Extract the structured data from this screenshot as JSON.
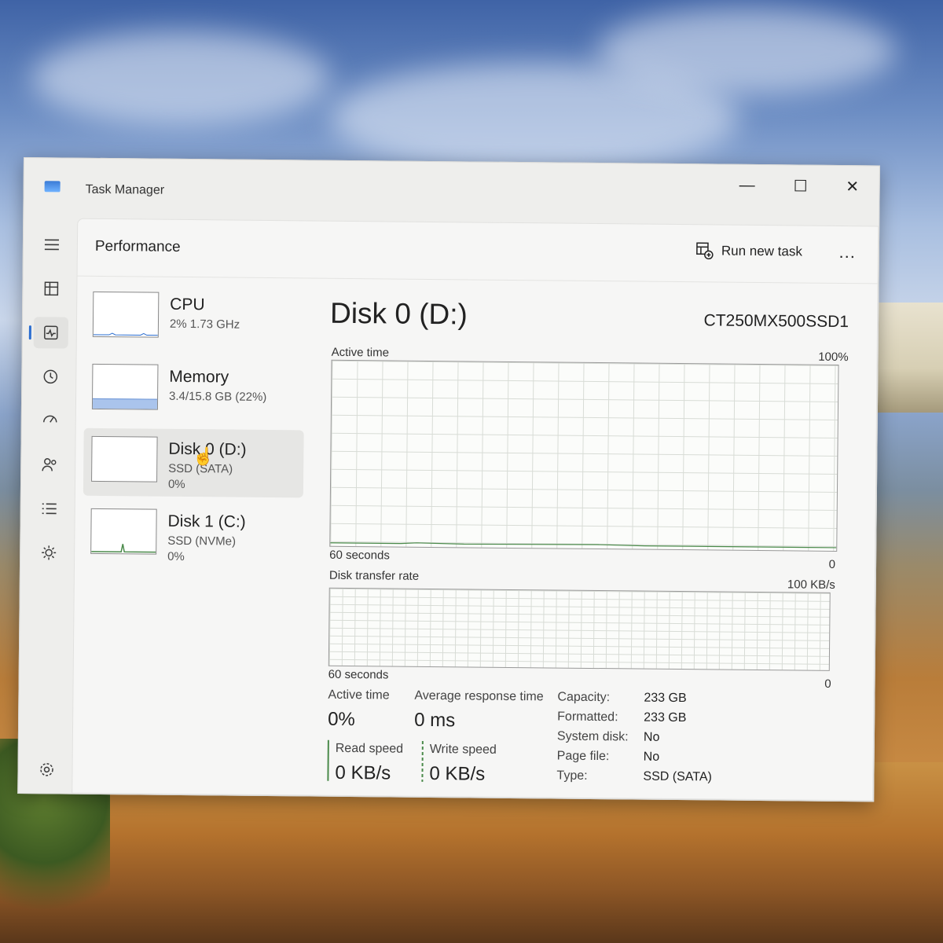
{
  "window": {
    "title": "Task Manager",
    "minimize": "—",
    "maximize": "☐",
    "close": "✕"
  },
  "sidebar": {
    "items": [
      {
        "icon": "hamburger-icon"
      },
      {
        "icon": "processes-icon"
      },
      {
        "icon": "performance-icon",
        "active": true
      },
      {
        "icon": "app-history-icon"
      },
      {
        "icon": "startup-apps-icon"
      },
      {
        "icon": "users-icon"
      },
      {
        "icon": "details-icon"
      },
      {
        "icon": "services-icon"
      }
    ],
    "settings_icon": "settings-gear-icon"
  },
  "header": {
    "page_title": "Performance",
    "run_new_task": "Run new task",
    "more": "..."
  },
  "devices": [
    {
      "name": "CPU",
      "sub1": "2%  1.73 GHz",
      "sub2": ""
    },
    {
      "name": "Memory",
      "sub1": "3.4/15.8 GB (22%)",
      "sub2": ""
    },
    {
      "name": "Disk 0 (D:)",
      "sub1": "SSD (SATA)",
      "sub2": "0%",
      "selected": true
    },
    {
      "name": "Disk 1 (C:)",
      "sub1": "SSD (NVMe)",
      "sub2": "0%"
    }
  ],
  "detail": {
    "title": "Disk 0 (D:)",
    "model": "CT250MX500SSD1",
    "active_time_graph": {
      "label": "Active time",
      "max_label": "100%",
      "x_label": "60 seconds",
      "min_label": "0"
    },
    "transfer_graph": {
      "label": "Disk transfer rate",
      "max_label": "100 KB/s",
      "x_label": "60 seconds",
      "min_label": "0"
    },
    "stats": {
      "active_time_label": "Active time",
      "active_time_value": "0%",
      "avg_response_label": "Average response time",
      "avg_response_value": "0 ms",
      "read_speed_label": "Read speed",
      "read_speed_value": "0 KB/s",
      "write_speed_label": "Write speed",
      "write_speed_value": "0 KB/s"
    },
    "properties": [
      {
        "key": "Capacity:",
        "value": "233 GB"
      },
      {
        "key": "Formatted:",
        "value": "233 GB"
      },
      {
        "key": "System disk:",
        "value": "No"
      },
      {
        "key": "Page file:",
        "value": "No"
      },
      {
        "key": "Type:",
        "value": "SSD (SATA)"
      }
    ]
  },
  "colors": {
    "accent": "#2a6dd0",
    "graph_line": "#4a8a4a",
    "memory_fill": "#aac4ec"
  }
}
